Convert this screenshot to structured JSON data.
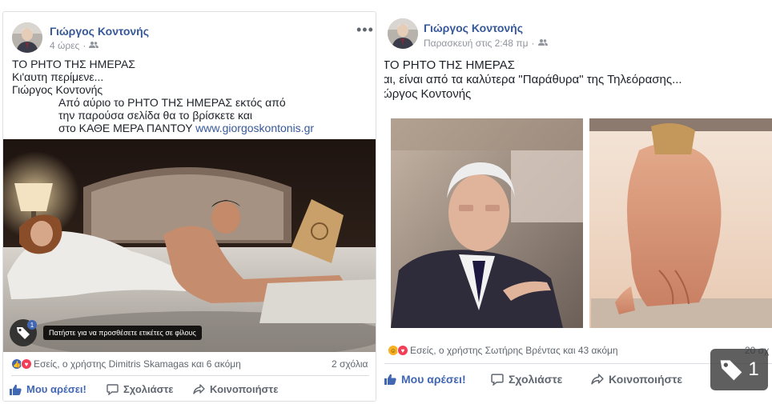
{
  "left_post": {
    "author": "Γιώργος Κοντονής",
    "time": "4 ώρες",
    "more": "•••",
    "lines": [
      "ΤΟ ΡΗΤΟ ΤΗΣ ΗΜΕΡΑΣ",
      "Κι'αυτη περίμενε...",
      "Γιώργος Κοντονής",
      "Από αύριο το ΡΗΤΟ ΤΗΣ ΗΜΕΡΑΣ εκτός  από",
      "την παρούσα σελίδα θα το βρίσκετε και",
      "στο ΚΑΘΕ ΜΕΡΑ ΠΑΝΤΟΥ "
    ],
    "link": "www.giorgoskontonis.gr",
    "tag_tooltip": "Πατήστε για να προσθέσετε ετικέτες σε φίλους",
    "tag_badge": "1",
    "reactions_text": "Εσείς, ο χρήστης Dimitris Skamagas και 6 ακόμη",
    "comments_count": "2 σχόλια",
    "actions": {
      "like": "Μου αρέσει!",
      "comment": "Σχολιάστε",
      "share": "Κοινοποιήστε"
    }
  },
  "right_post": {
    "author": "Γιώργος Κοντονής",
    "time": "Παρασκευή στις 2:48 πμ",
    "lines": [
      "ΤΟ ΡΗΤΟ ΤΗΣ ΗΜΕΡΑΣ",
      "αι, είναι από τα καλύτερα \"Παράθυρα\" της Τηλεόρασης...",
      "ώργος Κοντονής"
    ],
    "reactions_text": "Εσείς, ο χρήστης Σωτήρης Βρέντας και 43 ακόμη",
    "comments_count": "20 σχ",
    "actions": {
      "like": "Μου αρέσει!",
      "comment": "Σχολιάστε",
      "share": "Κοινοποιήστε"
    }
  },
  "tag_overlay_count": "1",
  "colors": {
    "link": "#365899",
    "like_blue": "#4267b2",
    "meta_gray": "#90949c",
    "love_red": "#f33e58",
    "haha_yellow": "#f7b125"
  }
}
